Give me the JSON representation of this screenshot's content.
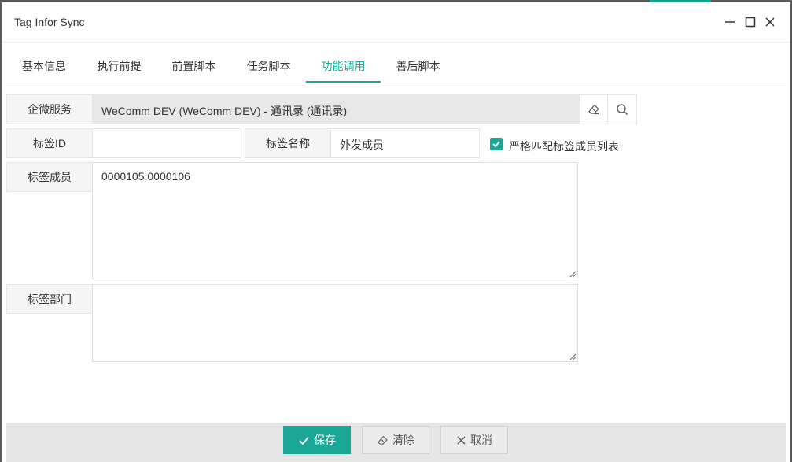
{
  "window": {
    "title": "Tag Infor Sync"
  },
  "tabs": [
    {
      "label": "基本信息"
    },
    {
      "label": "执行前提"
    },
    {
      "label": "前置脚本"
    },
    {
      "label": "任务脚本"
    },
    {
      "label": "功能调用",
      "active": true
    },
    {
      "label": "善后脚本"
    }
  ],
  "form": {
    "service": {
      "label": "企微服务",
      "value": "WeComm DEV (WeComm DEV) - 通讯录 (通讯录)"
    },
    "tag_id": {
      "label": "标签ID",
      "value": ""
    },
    "tag_name": {
      "label": "标签名称",
      "value": "外发成员"
    },
    "strict_match": {
      "label": "严格匹配标签成员列表",
      "checked": true
    },
    "tag_members": {
      "label": "标签成员",
      "value": "0000105;0000106"
    },
    "tag_departments": {
      "label": "标签部门",
      "value": ""
    }
  },
  "footer": {
    "save_label": "保存",
    "clear_label": "清除",
    "cancel_label": "取消"
  },
  "colors": {
    "accent": "#1aa795",
    "footer_bg": "#e6e6e6",
    "readonly_bg": "#e8e8e8"
  },
  "icons": [
    "minimize-icon",
    "maximize-icon",
    "close-icon",
    "eraser-icon",
    "search-icon",
    "check-icon"
  ]
}
